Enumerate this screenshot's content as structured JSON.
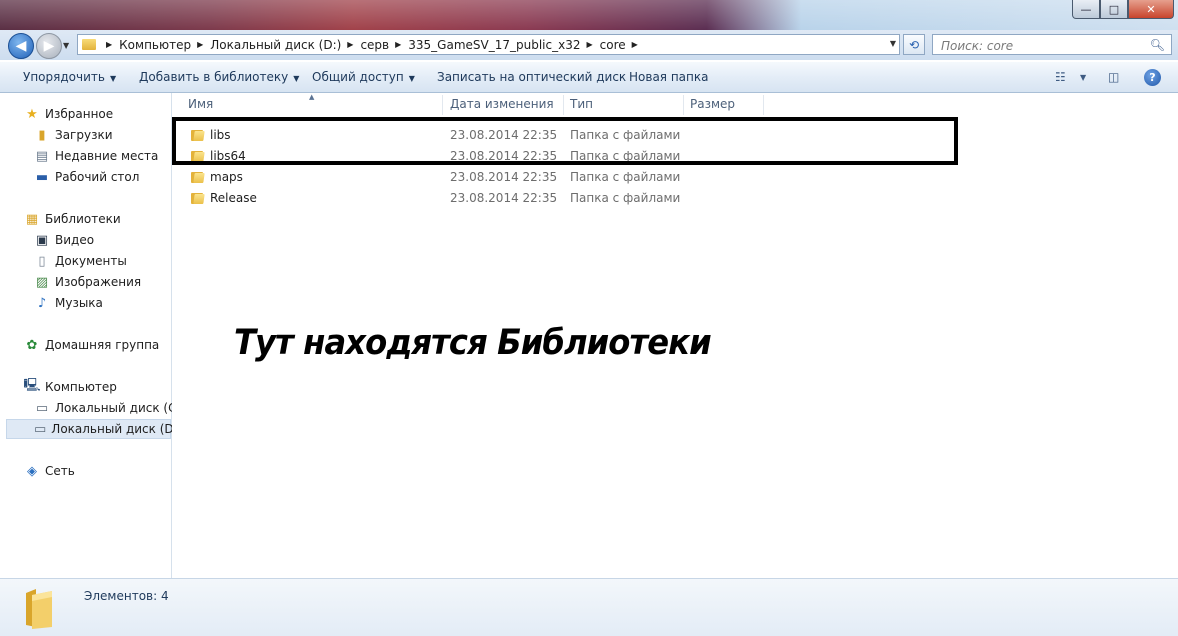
{
  "window": {
    "controls": {
      "minimize": "—",
      "maximize": "□",
      "close": "✕"
    }
  },
  "address": {
    "crumbs": [
      "Компьютер",
      "Локальный диск  (D:)",
      "серв",
      "335_GameSV_17_public_x32",
      "core"
    ],
    "search_placeholder": "Поиск: core"
  },
  "toolbar": {
    "organize": "Упорядочить",
    "add_to_library": "Добавить в библиотеку",
    "share": "Общий доступ",
    "burn": "Записать на оптический диск",
    "new_folder": "Новая папка",
    "help": "?"
  },
  "nav": {
    "favorites": "Избранное",
    "downloads": "Загрузки",
    "recent": "Недавние места",
    "desktop": "Рабочий стол",
    "libraries": "Библиотеки",
    "video": "Видео",
    "documents": "Документы",
    "pictures": "Изображения",
    "music": "Музыка",
    "homegroup": "Домашняя группа",
    "computer": "Компьютер",
    "drive_c": "Локальный диск (C:)",
    "drive_d": "Локальный диск  (D:)",
    "network": "Сеть"
  },
  "columns": {
    "name": "Имя",
    "date": "Дата изменения",
    "type": "Тип",
    "size": "Размер"
  },
  "files": [
    {
      "name": "libs",
      "date": "23.08.2014 22:35",
      "type": "Папка с файлами"
    },
    {
      "name": "libs64",
      "date": "23.08.2014 22:35",
      "type": "Папка с файлами"
    },
    {
      "name": "maps",
      "date": "23.08.2014 22:35",
      "type": "Папка с файлами"
    },
    {
      "name": "Release",
      "date": "23.08.2014 22:35",
      "type": "Папка с файлами"
    }
  ],
  "annotation": "Тут находятся Библиотеки",
  "status": {
    "items": "Элементов: 4"
  }
}
